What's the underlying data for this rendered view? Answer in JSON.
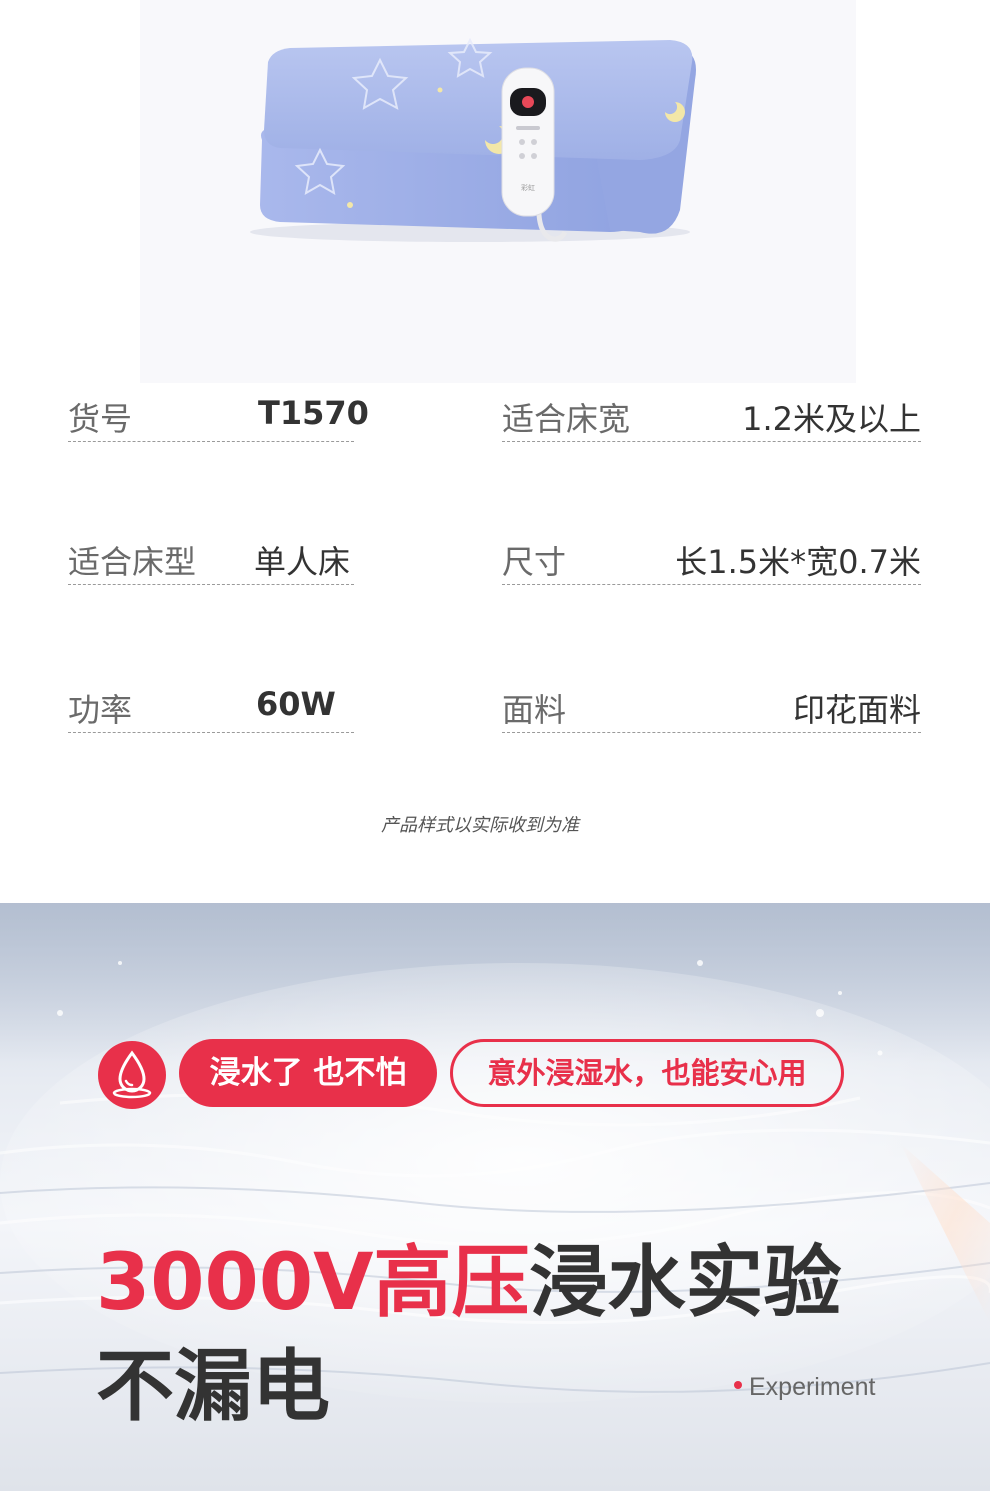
{
  "product": {
    "image_alt": "blue star-pattern electric blanket with controller",
    "controller_text": "彩虹"
  },
  "specs": [
    {
      "label": "货号",
      "value": "T1570"
    },
    {
      "label": "适合床宽",
      "value": "1.2米及以上"
    },
    {
      "label": "适合床型",
      "value": "单人床"
    },
    {
      "label": "尺寸",
      "value": "长1.5米*宽0.7米"
    },
    {
      "label": "功率",
      "value": "60W"
    },
    {
      "label": "面料",
      "value": "印花面料"
    }
  ],
  "note": "产品样式以实际收到为准",
  "hero": {
    "icon": "water-drop-icon",
    "badge_solid": "浸水了 也不怕",
    "badge_outline": "意外浸湿水，也能安心用",
    "headline_red": "3000V高压",
    "headline_dark": "浸水实验",
    "headline_line2": "不漏电",
    "tag": "Experiment"
  },
  "colors": {
    "accent": "#e8304a",
    "text_dark": "#333333",
    "label_gray": "#6a6a6a",
    "blanket_blue": "#a8b8ea"
  }
}
